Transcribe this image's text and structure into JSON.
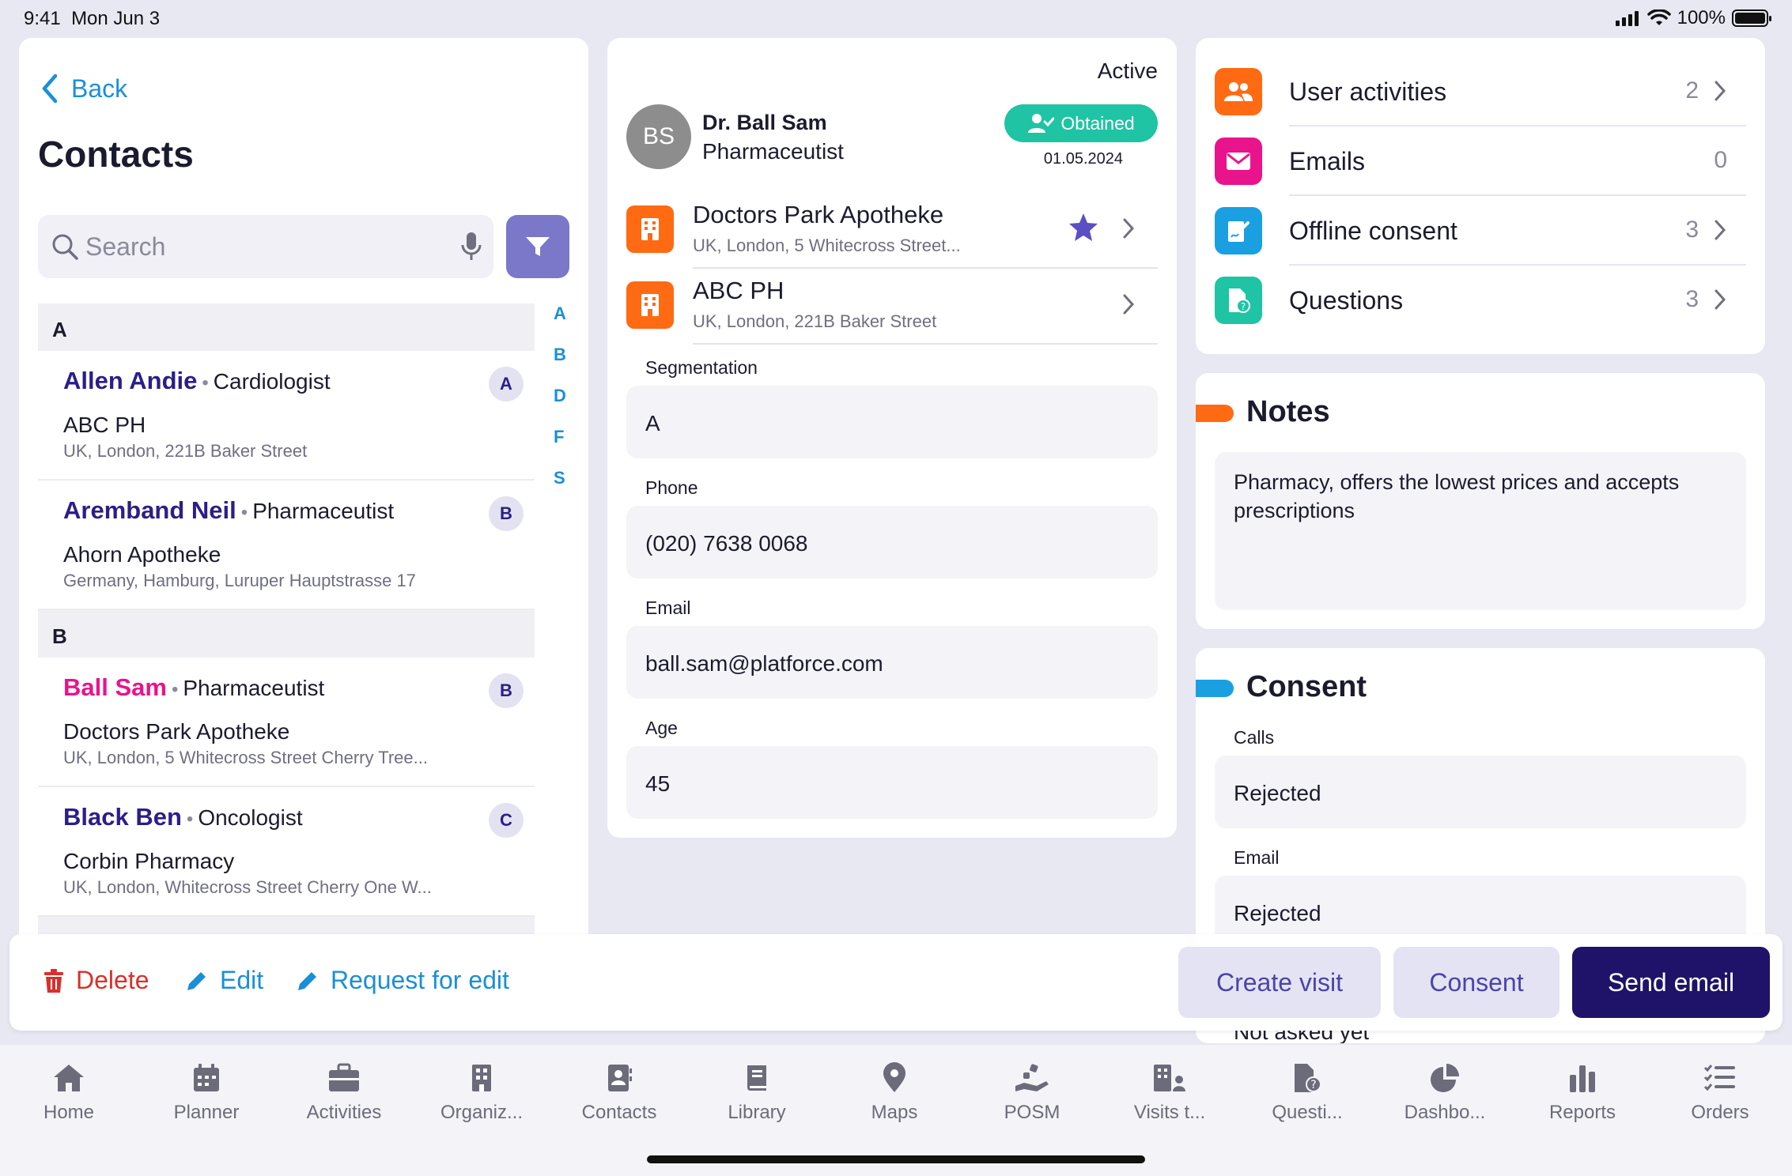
{
  "status_bar": {
    "time": "9:41",
    "date": "Mon Jun 3",
    "battery": "100%"
  },
  "left": {
    "back_label": "Back",
    "title": "Contacts",
    "search_placeholder": "Search",
    "alpha_index": [
      "A",
      "B",
      "D",
      "F",
      "S"
    ],
    "sections": [
      {
        "letter": "A",
        "contacts": [
          {
            "name": "Allen Andie",
            "role": "Cardiologist",
            "org": "ABC PH",
            "address": "UK, London, 221B Baker Street",
            "badge": "A"
          },
          {
            "name": "Aremband Neil",
            "role": "Pharmaceutist",
            "org": "Ahorn Apotheke",
            "address": "Germany, Hamburg, Luruper Hauptstrasse 17",
            "badge": "B"
          }
        ]
      },
      {
        "letter": "B",
        "contacts": [
          {
            "name": "Ball Sam",
            "role": "Pharmaceutist",
            "org": "Doctors Park Apotheke",
            "address": "UK, London, 5 Whitecross Street Cherry Tree...",
            "badge": "B"
          },
          {
            "name": "Black Ben",
            "role": "Oncologist",
            "org": "Corbin Pharmacy",
            "address": "UK, London, Whitecross Street Cherry One W...",
            "badge": "C"
          }
        ]
      }
    ],
    "separator": "•"
  },
  "detail": {
    "status": "Active",
    "avatar_initials": "BS",
    "name": "Dr. Ball Sam",
    "role": "Pharmaceutist",
    "consent_badge": "Obtained",
    "consent_date": "01.05.2024",
    "organizations": [
      {
        "name": "Doctors Park Apotheke",
        "address": "UK, London, 5 Whitecross Street...",
        "favorite": true
      },
      {
        "name": "ABC PH",
        "address": "UK, London, 221B Baker Street",
        "favorite": false
      }
    ],
    "fields": [
      {
        "label": "Segmentation",
        "value": "A"
      },
      {
        "label": "Phone",
        "value": "(020) 7638 0068"
      },
      {
        "label": "Email",
        "value": "ball.sam@platforce.com"
      },
      {
        "label": "Age",
        "value": "45"
      }
    ]
  },
  "summary": {
    "items": [
      {
        "label": "User activities",
        "count": "2",
        "color": "#ff6a13",
        "icon": "users-icon",
        "chevron": true
      },
      {
        "label": "Emails",
        "count": "0",
        "color": "#e9138c",
        "icon": "mail-icon",
        "chevron": false
      },
      {
        "label": "Offline consent",
        "count": "3",
        "color": "#1a9fe0",
        "icon": "signature-icon",
        "chevron": true
      },
      {
        "label": "Questions",
        "count": "3",
        "color": "#1fc4a4",
        "icon": "question-doc-icon",
        "chevron": true
      }
    ]
  },
  "notes": {
    "title": "Notes",
    "text": "Pharmacy, offers the lowest prices and accepts prescriptions",
    "accent": "#ff6a13"
  },
  "consent": {
    "title": "Consent",
    "accent": "#1a9fe0",
    "fields": [
      {
        "label": "Calls",
        "value": "Rejected"
      },
      {
        "label": "Email",
        "value": "Rejected"
      }
    ],
    "partial_text": "Not asked yet"
  },
  "actions": {
    "delete": "Delete",
    "edit": "Edit",
    "request_edit": "Request for edit",
    "create_visit": "Create visit",
    "consent": "Consent",
    "send_email": "Send email"
  },
  "tabs": [
    {
      "label": "Home",
      "icon": "home-icon"
    },
    {
      "label": "Planner",
      "icon": "calendar-icon"
    },
    {
      "label": "Activities",
      "icon": "briefcase-icon"
    },
    {
      "label": "Organiz...",
      "icon": "building-icon"
    },
    {
      "label": "Contacts",
      "icon": "contacts-icon"
    },
    {
      "label": "Library",
      "icon": "book-icon"
    },
    {
      "label": "Maps",
      "icon": "map-pin-icon"
    },
    {
      "label": "POSM",
      "icon": "posm-icon"
    },
    {
      "label": "Visits t...",
      "icon": "visits-icon"
    },
    {
      "label": "Questi...",
      "icon": "questionnaire-icon"
    },
    {
      "label": "Dashbo...",
      "icon": "pie-chart-icon"
    },
    {
      "label": "Reports",
      "icon": "bar-chart-icon"
    },
    {
      "label": "Orders",
      "icon": "checklist-icon"
    }
  ]
}
